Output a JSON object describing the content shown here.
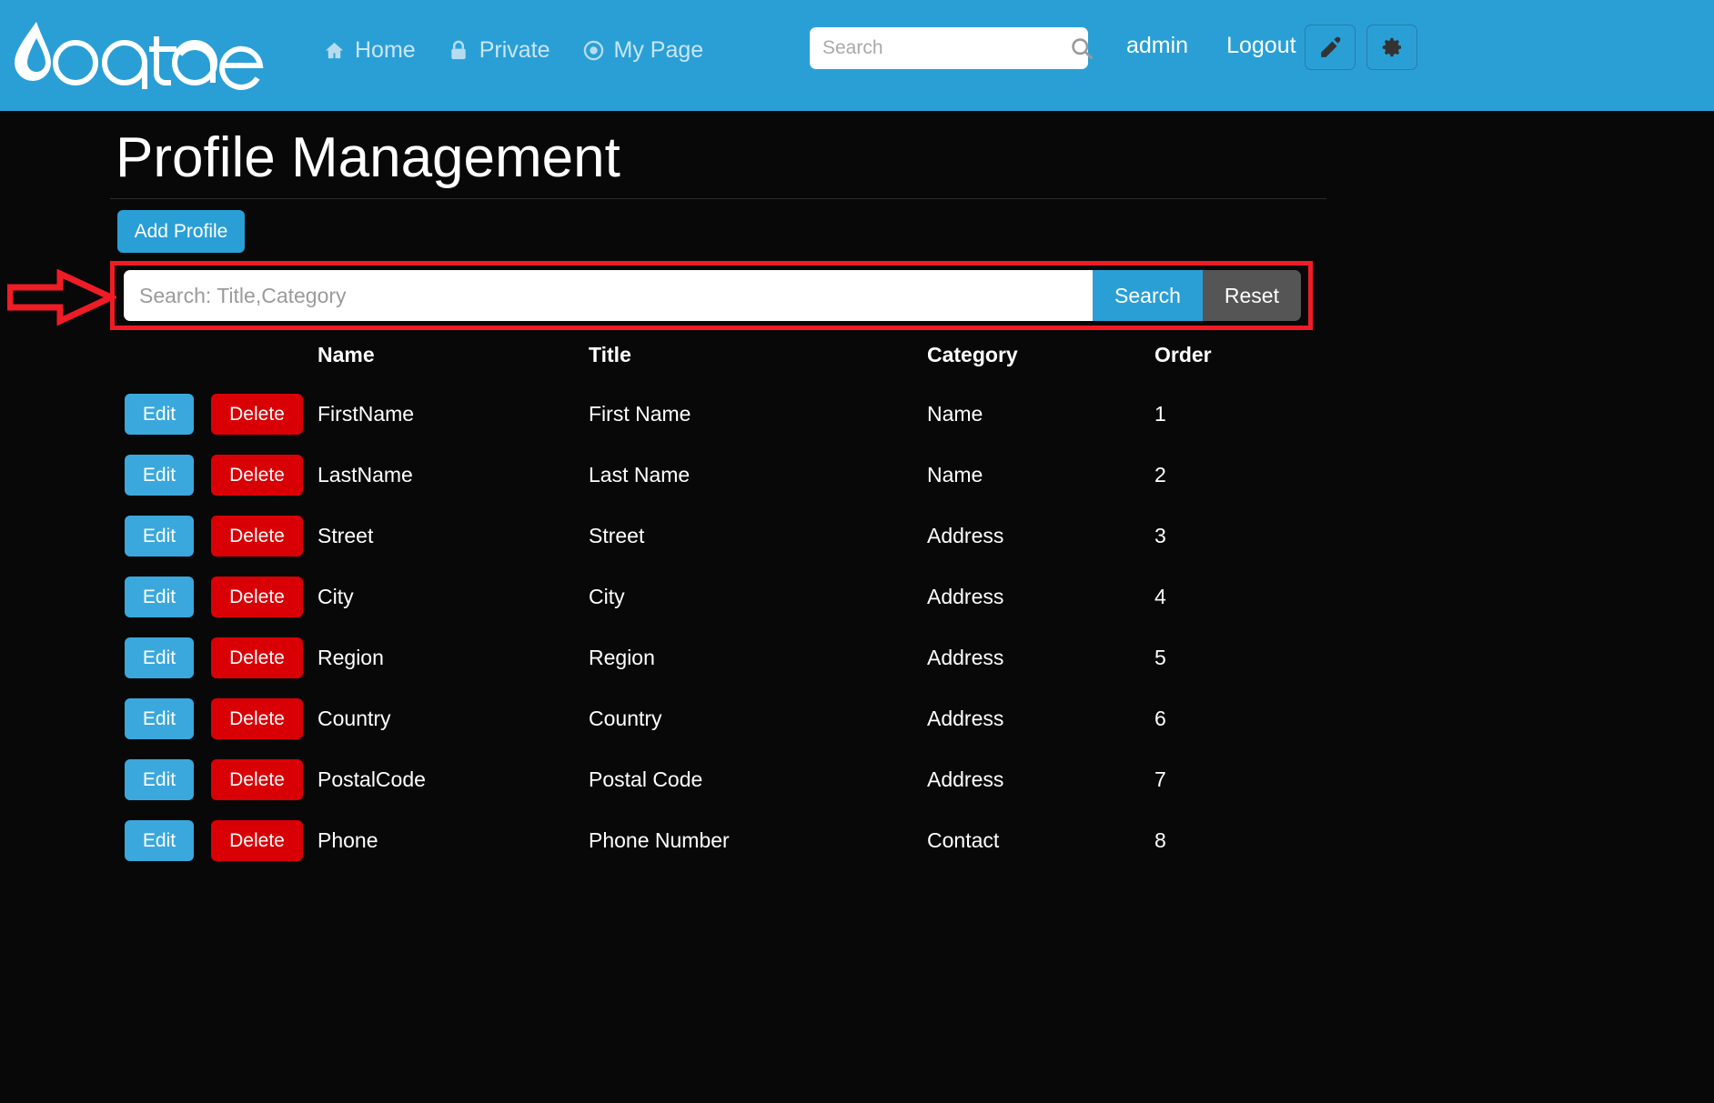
{
  "header": {
    "brand": "oqtane",
    "nav": [
      {
        "label": "Home",
        "icon": "home-icon"
      },
      {
        "label": "Private",
        "icon": "lock-icon"
      },
      {
        "label": "My Page",
        "icon": "target-icon"
      }
    ],
    "search": {
      "placeholder": "Search",
      "value": "",
      "icon": "search-icon"
    },
    "user": "admin",
    "logout": "Logout",
    "edit_icon": "pencil-icon",
    "settings_icon": "gear-icon",
    "accent": "#2a9fd6"
  },
  "main": {
    "title": "Profile Management",
    "add_button": "Add Profile",
    "filter": {
      "placeholder": "Search: Title,Category",
      "value": "",
      "search_button": "Search",
      "reset_button": "Reset"
    },
    "annotation": {
      "color": "#ef1c25",
      "shape": "arrow-pointing-right-at-search-box"
    },
    "table": {
      "columns": [
        "",
        "Name",
        "Title",
        "Category",
        "Order"
      ],
      "row_actions": {
        "edit": "Edit",
        "delete": "Delete"
      },
      "rows": [
        {
          "name": "FirstName",
          "title": "First Name",
          "category": "Name",
          "order": "1"
        },
        {
          "name": "LastName",
          "title": "Last Name",
          "category": "Name",
          "order": "2"
        },
        {
          "name": "Street",
          "title": "Street",
          "category": "Address",
          "order": "3"
        },
        {
          "name": "City",
          "title": "City",
          "category": "Address",
          "order": "4"
        },
        {
          "name": "Region",
          "title": "Region",
          "category": "Address",
          "order": "5"
        },
        {
          "name": "Country",
          "title": "Country",
          "category": "Address",
          "order": "6"
        },
        {
          "name": "PostalCode",
          "title": "Postal Code",
          "category": "Address",
          "order": "7"
        },
        {
          "name": "Phone",
          "title": "Phone Number",
          "category": "Contact",
          "order": "8"
        }
      ]
    }
  }
}
